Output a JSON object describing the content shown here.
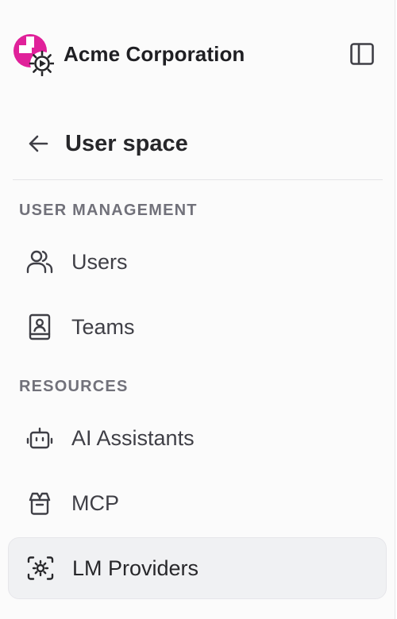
{
  "header": {
    "org_name": "Acme Corporation",
    "logo_icon": "acme-logo-icon",
    "toggle_icon": "sidebar-toggle-icon"
  },
  "space": {
    "back_icon": "arrow-left-icon",
    "title": "User space"
  },
  "sections": [
    {
      "label": "USER MANAGEMENT",
      "items": [
        {
          "label": "Users",
          "icon": "users-icon"
        },
        {
          "label": "Teams",
          "icon": "contact-book-icon"
        }
      ]
    },
    {
      "label": "RESOURCES",
      "items": [
        {
          "label": "AI Assistants",
          "icon": "bot-icon"
        },
        {
          "label": "MCP",
          "icon": "package-icon"
        },
        {
          "label": "LM Providers",
          "icon": "cog-frame-icon",
          "active": true
        }
      ]
    }
  ],
  "colors": {
    "logo_magenta": "#e0219a",
    "active_bg": "#f0f1f3",
    "section_label": "#71717a"
  }
}
